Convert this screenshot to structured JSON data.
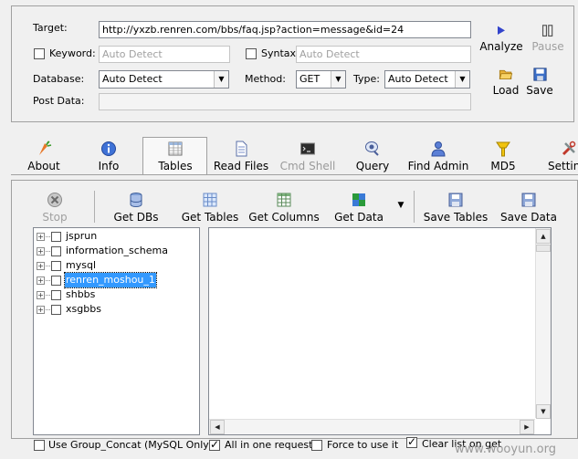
{
  "form": {
    "target_label": "Target:",
    "target_value": "http://yxzb.renren.com/bbs/faq.jsp?action=message&id=24",
    "keyword_label": "Keyword:",
    "keyword_value": "Auto Detect",
    "syntax_label": "Syntax:",
    "syntax_value": "Auto Detect",
    "database_label": "Database:",
    "database_value": "Auto Detect",
    "method_label": "Method:",
    "method_value": "GET",
    "type_label": "Type:",
    "type_value": "Auto Detect",
    "postdata_label": "Post Data:",
    "postdata_value": ""
  },
  "actions": {
    "analyze": "Analyze",
    "pause": "Pause",
    "load": "Load",
    "save": "Save"
  },
  "tabs": [
    {
      "label": "About",
      "icon": "carrot-icon"
    },
    {
      "label": "Info",
      "icon": "info-icon"
    },
    {
      "label": "Tables",
      "icon": "table-icon",
      "active": true
    },
    {
      "label": "Read Files",
      "icon": "file-icon"
    },
    {
      "label": "Cmd Shell",
      "icon": "terminal-icon",
      "disabled": true
    },
    {
      "label": "Query",
      "icon": "query-icon"
    },
    {
      "label": "Find Admin",
      "icon": "admin-icon"
    },
    {
      "label": "MD5",
      "icon": "key-icon"
    },
    {
      "label": "Setting",
      "icon": "tools-icon"
    }
  ],
  "toolbar": {
    "stop": "Stop",
    "get_dbs": "Get DBs",
    "get_tables": "Get Tables",
    "get_columns": "Get Columns",
    "get_data": "Get Data",
    "save_tables": "Save Tables",
    "save_data": "Save Data"
  },
  "databases": [
    {
      "name": "jsprun"
    },
    {
      "name": "information_schema"
    },
    {
      "name": "mysql"
    },
    {
      "name": "renren_moshou_1",
      "selected": true
    },
    {
      "name": "shbbs"
    },
    {
      "name": "xsgbbs"
    }
  ],
  "options": {
    "group_concat": "Use Group_Concat (MySQL Only)",
    "all_in_one": "All in one request.",
    "force": "Force to use it",
    "clear_list": "Clear list on get"
  },
  "watermark": "www.wooyun.org",
  "colors": {
    "window_bg": "#f0f0f0",
    "selection": "#3399ff",
    "border": "#a0a0a0"
  }
}
